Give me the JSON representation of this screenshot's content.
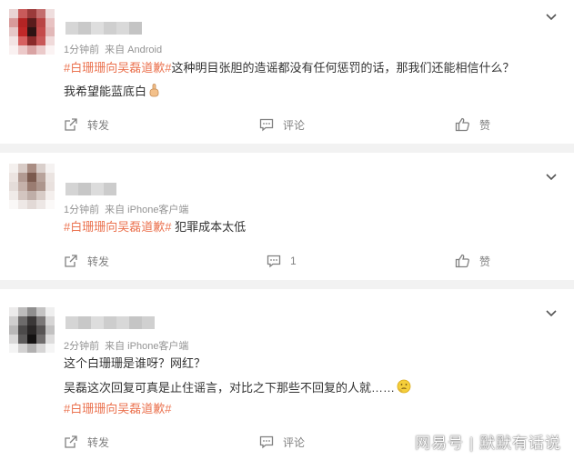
{
  "comments": [
    {
      "time": "1分钟前",
      "source": "来自 Android",
      "lines": [
        {
          "tag": "#白珊珊向吴磊道歉#",
          "text": "这种明目张胆的造谣都没有任何惩罚的话，那我们还能相信什么？"
        },
        {
          "tag": "",
          "text": "我希望能蓝底白"
        }
      ],
      "forward_label": "转发",
      "comment_label": "评论",
      "like_label": "赞"
    },
    {
      "time": "1分钟前",
      "source": "来自 iPhone客户端",
      "lines": [
        {
          "tag": "#白珊珊向吴磊道歉#",
          "text": " 犯罪成本太低"
        }
      ],
      "forward_label": "转发",
      "comment_label": "1",
      "like_label": "赞"
    },
    {
      "time": "2分钟前",
      "source": "来自 iPhone客户端",
      "lines": [
        {
          "tag": "",
          "text": "这个白珊珊是谁呀？网红？"
        },
        {
          "tag": "",
          "text": "吴磊这次回复可真是止住谣言，对比之下那些不回复的人就……"
        },
        {
          "tag": "#白珊珊向吴磊道歉#",
          "text": ""
        }
      ],
      "forward_label": "转发",
      "comment_label": "评论",
      "like_label": "赞"
    }
  ],
  "icons": {
    "forward": "share-arrow-icon",
    "comment": "comment-bubble-icon",
    "like": "thumbs-up-icon",
    "menu": "chevron-down-icon",
    "emoji_hand": "pointing-hand-emoji",
    "emoji_think": "thinking-face-emoji"
  },
  "colors": {
    "tag": "#eb7350",
    "meta": "#939393",
    "action": "#808080",
    "separator": "#f2f2f2"
  },
  "watermark": "网易号 | 默默有话说"
}
